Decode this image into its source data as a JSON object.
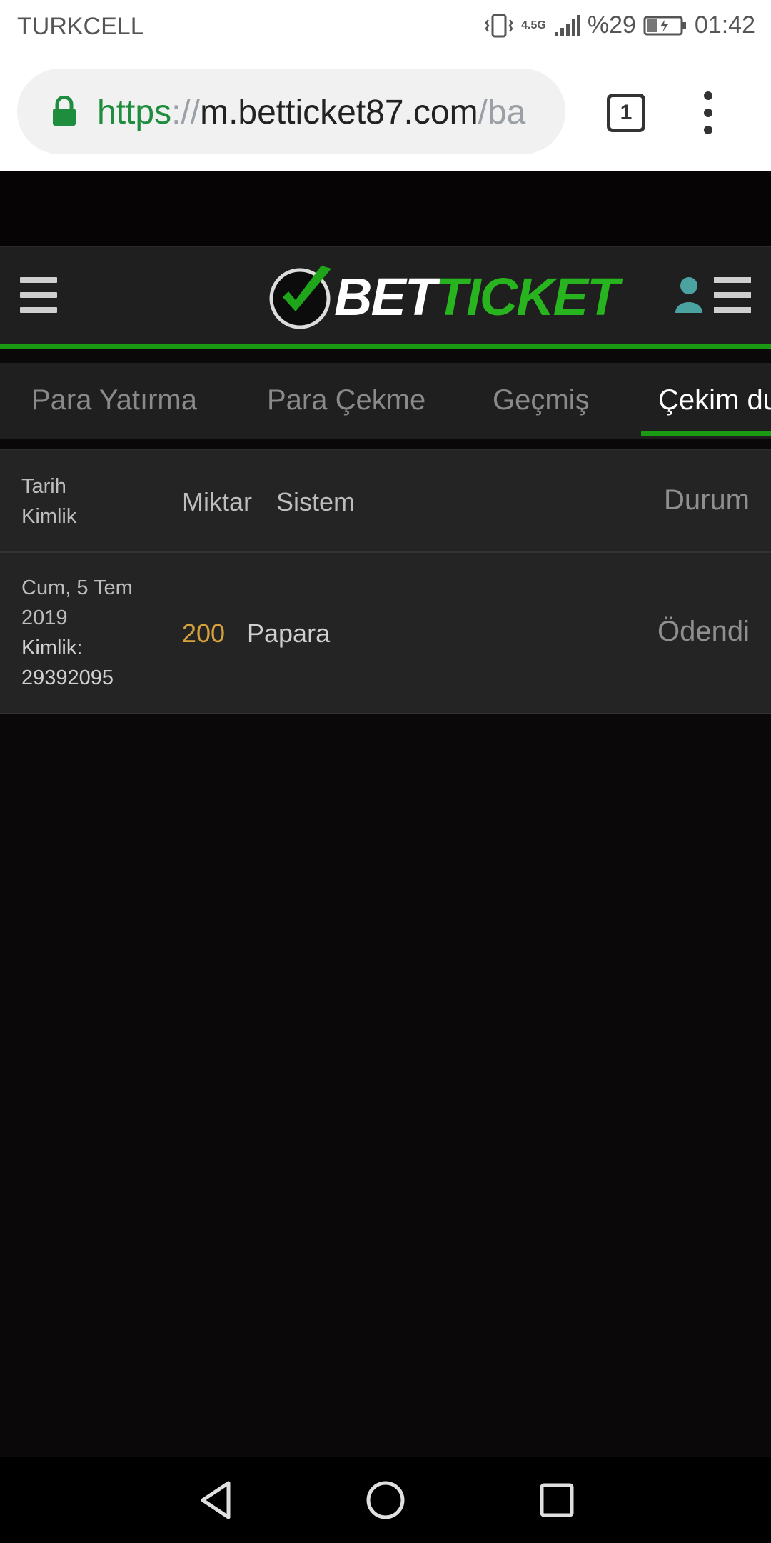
{
  "status_bar": {
    "carrier": "TURKCELL",
    "network": "4.5G",
    "battery": "%29",
    "time": "01:42"
  },
  "browser": {
    "url_scheme": "https",
    "url_sep": "://",
    "url_host": "m.betticket87.com",
    "url_path": "/ba",
    "tab_count": "1"
  },
  "header": {
    "logo_part1": "BET",
    "logo_part2": "TICKET"
  },
  "tabs": [
    {
      "label": "Para Yatırma"
    },
    {
      "label": "Para Çekme"
    },
    {
      "label": "Geçmiş"
    },
    {
      "label": "Çekim du"
    }
  ],
  "table": {
    "headers": {
      "date": "Tarih",
      "id": "Kimlik",
      "amount": "Miktar",
      "system": "Sistem",
      "status": "Durum"
    },
    "rows": [
      {
        "date_line1": "Cum, 5 Tem",
        "date_line2": "2019",
        "id_label": "Kimlik:",
        "id_value": "29392095",
        "amount": "200",
        "system": "Papara",
        "status": "Ödendi"
      }
    ]
  },
  "colors": {
    "accent_green": "#1b9a13",
    "amount_gold": "#d6a03c",
    "background": "#0a0809"
  }
}
